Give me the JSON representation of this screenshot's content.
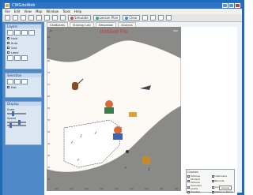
{
  "window": {
    "title": "CWGdeWeb"
  },
  "menu": [
    "File",
    "Edit",
    "View",
    "Map",
    "Window",
    "Tools",
    "Help"
  ],
  "toolbar": {
    "buttons": [
      "Simulate",
      "Lesson Plan",
      "Clear"
    ]
  },
  "tabs": [
    "GeoBoards",
    "Strategy Lab",
    "Simulation",
    "Analysis"
  ],
  "sidebar": {
    "panel1": {
      "title": "Layers",
      "opt1": "Hold",
      "opt2": "Auto",
      "opt3": "Grid",
      "opt4": "Label"
    },
    "panel2": {
      "title": "Selection",
      "opt1": "Edit"
    },
    "panel3": {
      "title": "Display",
      "opt1": "Scale",
      "opt2": "Speed"
    }
  },
  "map": {
    "title": "Untitled File",
    "corner_left": "40",
    "corner_right": "300",
    "y_labels": [
      "90",
      "85",
      "80",
      "75",
      "70",
      "65",
      "60",
      "55",
      "50",
      "45",
      "40",
      "35",
      "30"
    ],
    "x_labels": [
      "100",
      "150",
      "200",
      "250",
      "300",
      "350",
      "400",
      "450",
      "500"
    ]
  },
  "legend": {
    "title": "Choices",
    "items": [
      "Pictures",
      "Unknowns",
      "Student Pictures",
      "Records",
      "Unknown points",
      "Group Names",
      "Possibly",
      "Distance Name"
    ],
    "cancel": "Cancel"
  },
  "colors": {
    "frame": "#1f6bb8",
    "sidebar": "#4f88c6",
    "terrain": "#8a8a88",
    "selection": "#ffffff"
  }
}
